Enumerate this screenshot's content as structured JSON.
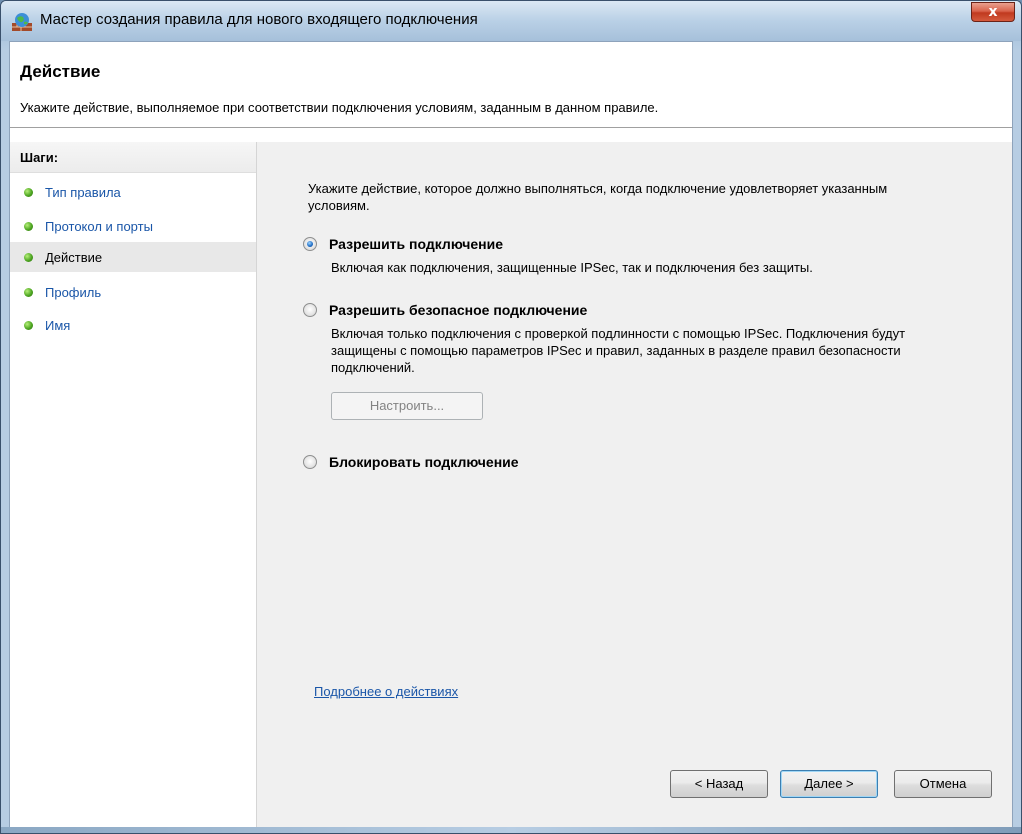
{
  "window": {
    "title": "Мастер создания правила для нового входящего подключения",
    "close_glyph": "x"
  },
  "header": {
    "title": "Действие",
    "description": "Укажите действие, выполняемое при соответствии подключения условиям, заданным в данном правиле."
  },
  "steps": {
    "heading": "Шаги:",
    "items": [
      {
        "label": "Тип правила",
        "active": false
      },
      {
        "label": "Протокол и порты",
        "active": false
      },
      {
        "label": "Действие",
        "active": true
      },
      {
        "label": "Профиль",
        "active": false
      },
      {
        "label": "Имя",
        "active": false
      }
    ]
  },
  "main": {
    "intro": "Укажите действие, которое должно выполняться, когда подключение удовлетворяет указанным условиям.",
    "options": [
      {
        "label": "Разрешить подключение",
        "description": "Включая как подключения, защищенные IPSec, так и подключения без защиты.",
        "checked": true
      },
      {
        "label": "Разрешить безопасное подключение",
        "description": "Включая только подключения с проверкой подлинности с помощью IPSec. Подключения будут защищены с помощью параметров IPSec и правил, заданных в разделе правил безопасности подключений.",
        "checked": false
      },
      {
        "label": "Блокировать подключение",
        "description": "",
        "checked": false
      }
    ],
    "customize_button": "Настроить...",
    "more_link": "Подробнее о действиях"
  },
  "buttons": {
    "back": "< Назад",
    "next": "Далее >",
    "cancel": "Отмена"
  },
  "colors": {
    "link": "#1a56a8",
    "step_dot": "#4ea622",
    "close_button": "#c0391f"
  },
  "icons": {
    "app": "firewall-globe-icon",
    "bullet": "green-dot-icon"
  }
}
